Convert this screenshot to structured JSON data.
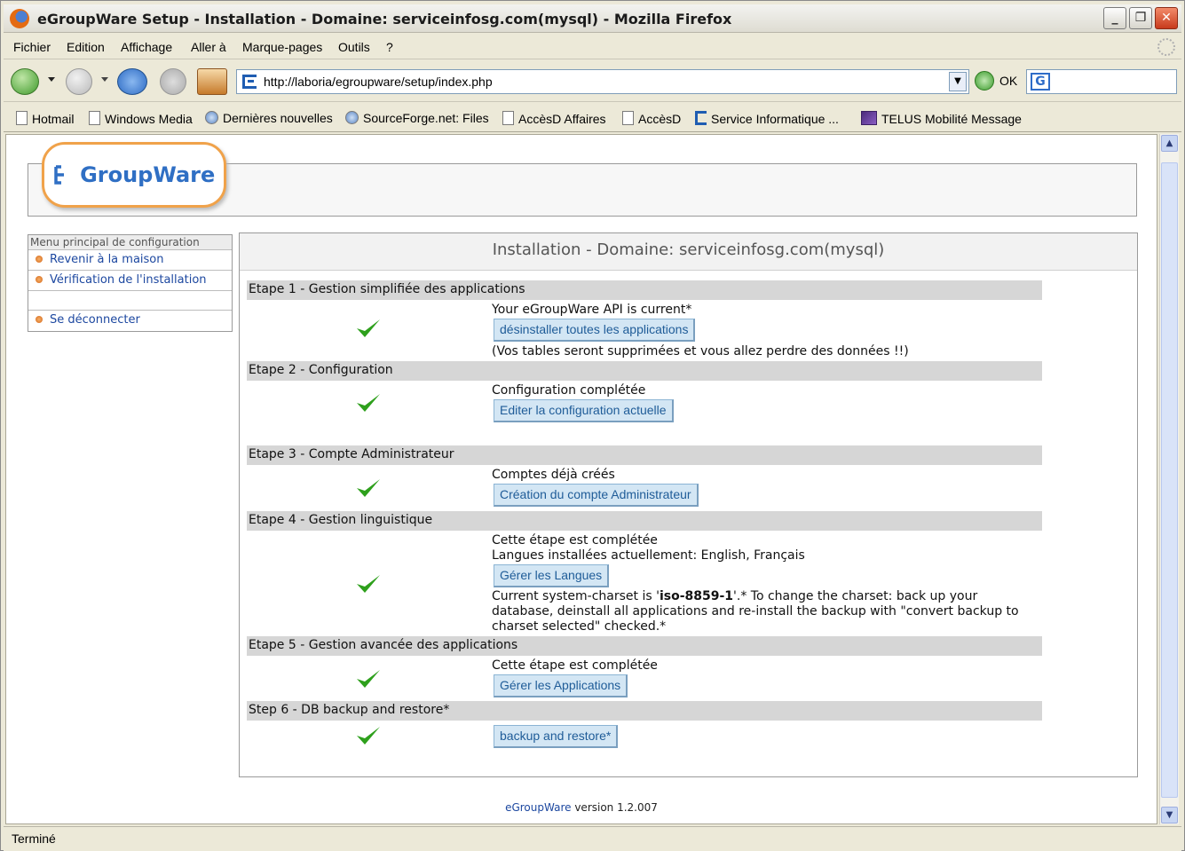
{
  "window": {
    "title": "eGroupWare Setup - Installation - Domaine: serviceinfosg.com(mysql) - Mozilla Firefox"
  },
  "menu": [
    "Fichier",
    "Edition",
    "Affichage",
    "Aller à",
    "Marque-pages",
    "Outils",
    "?"
  ],
  "nav": {
    "url": "http://laboria/egroupware/setup/index.php",
    "go_label": "OK"
  },
  "bookmarks": [
    {
      "label": "Hotmail",
      "icon": "page-icon"
    },
    {
      "label": "Windows Media",
      "icon": "page-icon"
    },
    {
      "label": "Dernières nouvelles",
      "icon": "rss-icon"
    },
    {
      "label": "SourceForge.net: Files",
      "icon": "rss-icon"
    },
    {
      "label": "AccèsD Affaires",
      "icon": "page-icon"
    },
    {
      "label": "AccèsD",
      "icon": "page-icon"
    },
    {
      "label": "Service Informatique ...",
      "icon": "egroupware-icon"
    },
    {
      "label": "TELUS Mobilité Message",
      "icon": "telus-icon"
    }
  ],
  "logo": {
    "brand": "GroupWare"
  },
  "sidebar": {
    "title": "Menu principal de configuration",
    "items": [
      "Revenir à la maison",
      "Vérification de l'installation",
      "Se déconnecter"
    ]
  },
  "main": {
    "title": "Installation - Domaine: serviceinfosg.com(mysql)",
    "steps": [
      {
        "header": "Etape 1 - Gestion simplifiée des applications",
        "lines": [
          "Your eGroupWare API is current*"
        ],
        "button": "désinstaller toutes les applications",
        "after": "(Vos tables seront supprimées et vous allez perdre des données !!)"
      },
      {
        "header": "Etape 2 - Configuration",
        "lines": [
          "Configuration complétée"
        ],
        "button": "Editer la configuration actuelle"
      },
      {
        "header": "Etape 3 - Compte Administrateur",
        "lines": [
          "Comptes déjà créés"
        ],
        "button": "Création du compte Administrateur"
      },
      {
        "header": "Etape 4 - Gestion linguistique",
        "lines": [
          "Cette étape est complétée",
          "Langues installées actuellement: English, Français"
        ],
        "button": "Gérer les Langues",
        "after_pre": "Current system-charset is '",
        "after_bold": "iso-8859-1",
        "after_post": "'.* To change the charset: back up your database, deinstall all applications and re-install the backup with \"convert backup to charset selected\" checked.*"
      },
      {
        "header": "Etape 5 - Gestion avancée des applications",
        "lines": [
          "Cette étape est complétée"
        ],
        "button": "Gérer les Applications"
      },
      {
        "header": "Step 6 - DB backup and restore*",
        "button": "backup and restore*"
      }
    ]
  },
  "footer": {
    "app": "eGroupWare",
    "version": "version 1.2.007"
  },
  "status": {
    "text": "Terminé"
  },
  "colors": {
    "accent": "#2f6fc4",
    "step_header": "#d6d6d6",
    "button_bg": "#d3e6f4",
    "check": "#2ea01c"
  }
}
